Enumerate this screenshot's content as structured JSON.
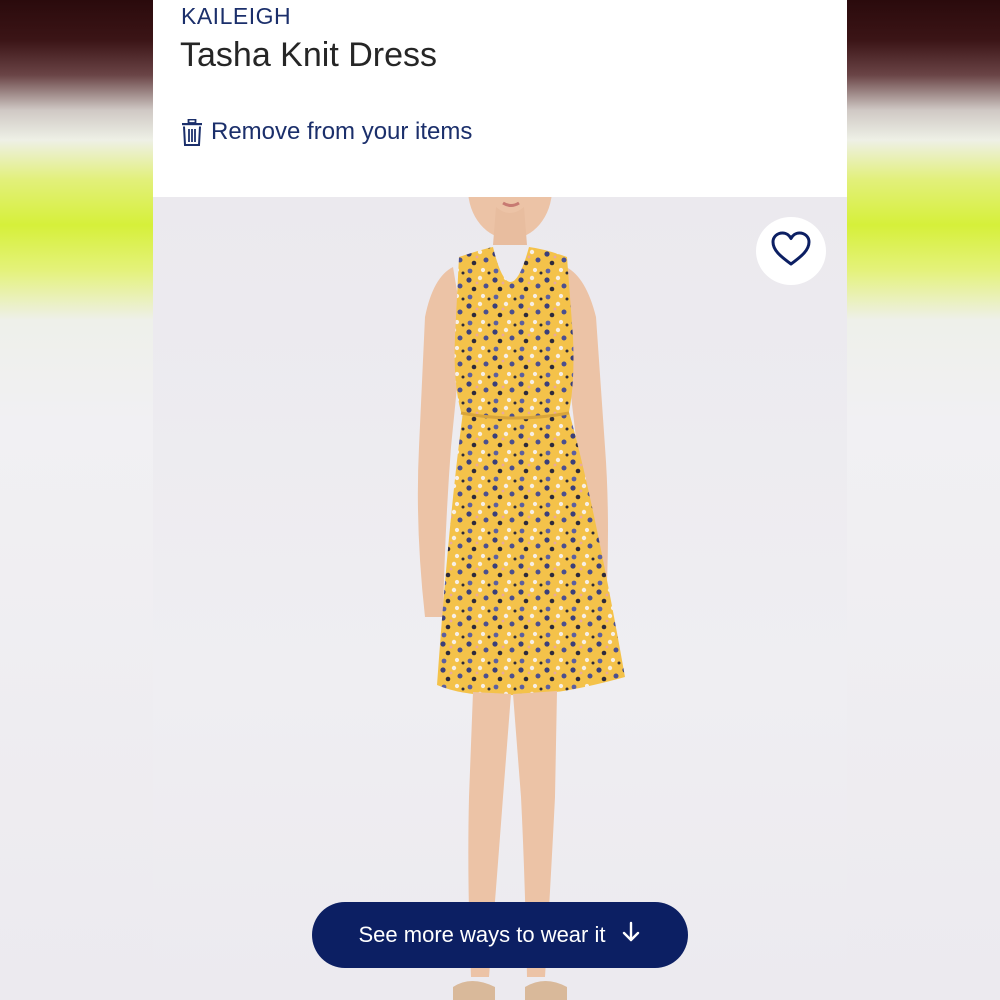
{
  "product": {
    "brand": "KAILEIGH",
    "title": "Tasha Knit Dress"
  },
  "actions": {
    "remove_label": "Remove from your items",
    "see_more_label": "See more ways to wear it"
  },
  "icons": {
    "remove": "trash-icon",
    "favorite": "heart-outline-icon",
    "see_more": "arrow-down-icon"
  },
  "colors": {
    "brand_navy": "#0c1f63",
    "link_navy": "#1b2f6b",
    "title_text": "#262626",
    "dress_yellow": "#f4c24a"
  }
}
